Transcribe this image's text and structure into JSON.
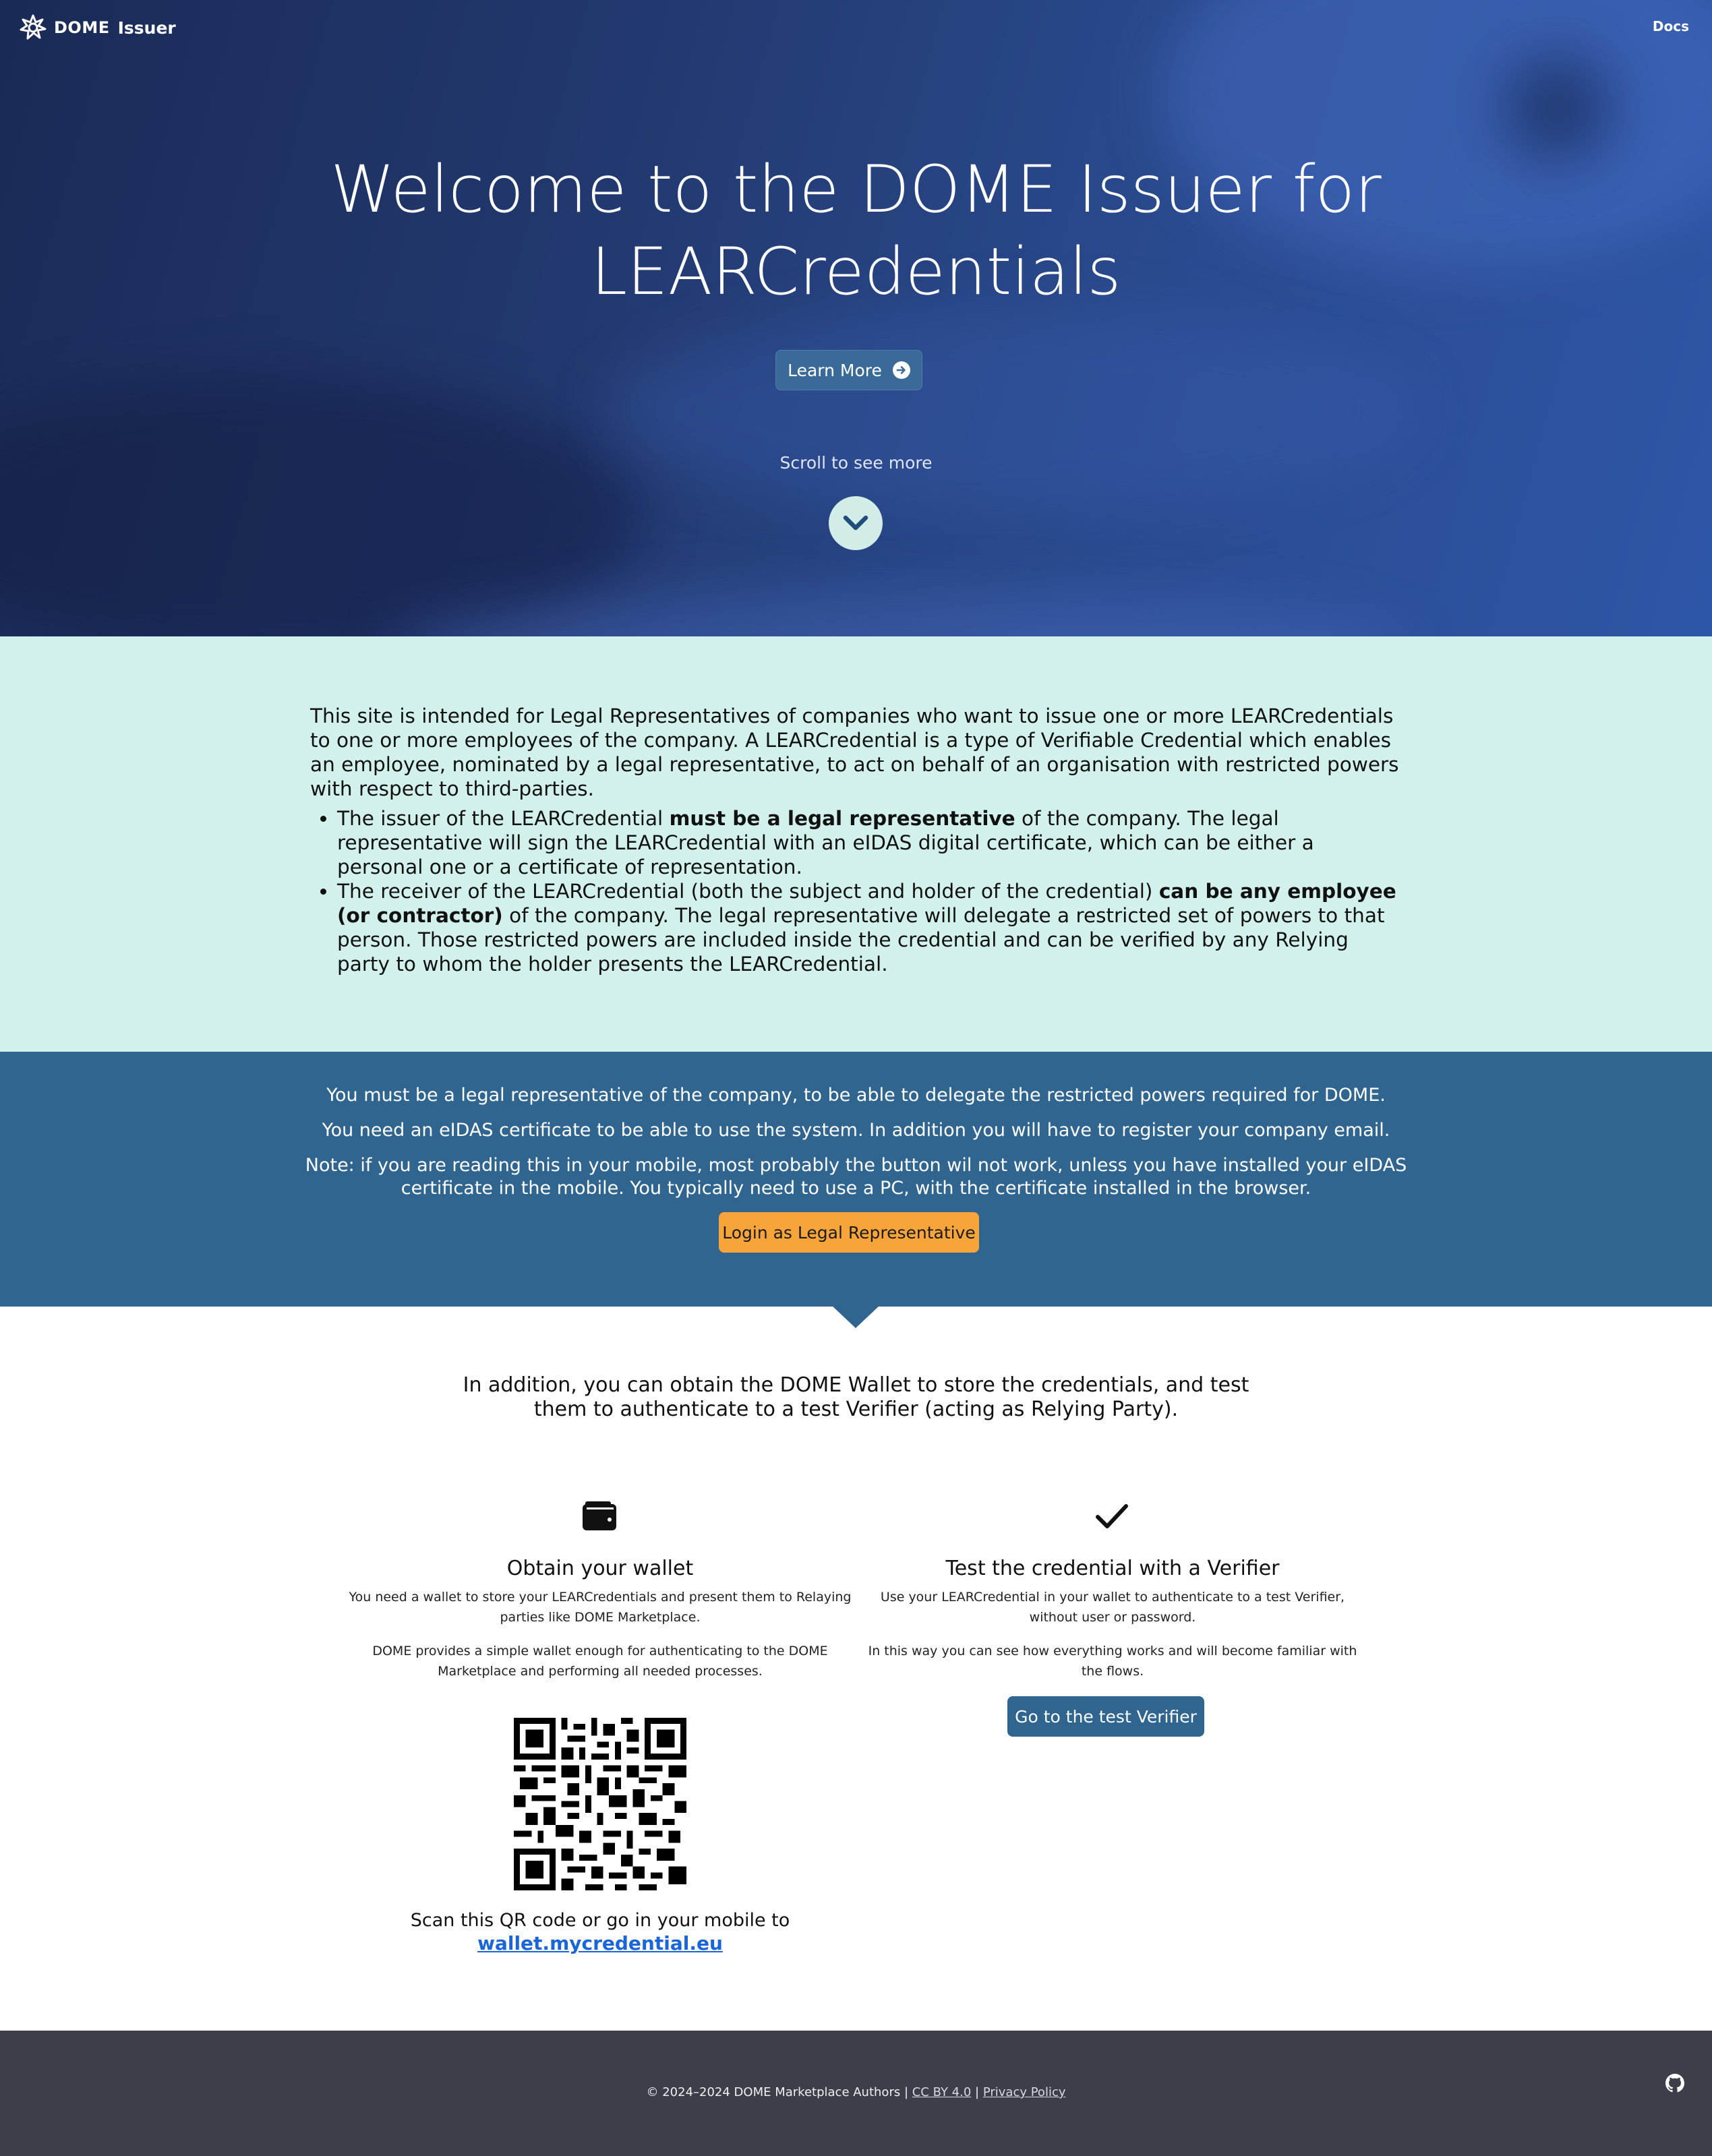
{
  "nav": {
    "brand_dome": "DOME",
    "brand_issuer": "Issuer",
    "docs_label": "Docs"
  },
  "hero": {
    "title_line1": "Welcome to the DOME Issuer for",
    "title_line2": "LEARCredentials",
    "learn_more_label": "Learn More",
    "scroll_hint": "Scroll to see more"
  },
  "intro": {
    "paragraph": "This site is intended for Legal Representatives of companies who want to issue one or more LEARCredentials to one or more employees of the company. A LEARCredential is a type of Verifiable Credential which enables an employee, nominated by a legal representative, to act on behalf of an organisation with restricted powers with respect to third-parties.",
    "bullet1_pre": "The issuer of the LEARCredential ",
    "bullet1_bold": "must be a legal representative",
    "bullet1_post": " of the company. The legal representative will sign the LEARCredential with an eIDAS digital certificate, which can be either a personal one or a certificate of representation.",
    "bullet2_pre": "The receiver of the LEARCredential (both the subject and holder of the credential) ",
    "bullet2_bold": "can be any employee (or contractor)",
    "bullet2_post": " of the company. The legal representative will delegate a restricted set of powers to that person. Those restricted powers are included inside the credential and can be verified by any Relying party to whom the holder presents the LEARCredential."
  },
  "notice": {
    "line1": "You must be a legal representative of the company, to be able to delegate the restricted powers required for DOME.",
    "line2": "You need an eIDAS certificate to be able to use the system. In addition you will have to register your company email.",
    "line3a": "Note: if you are reading this in your mobile, most probably the button wil not work, unless you have installed your eIDAS",
    "line3b": "certificate in the mobile. You typically need to use a PC, with the certificate installed in the browser.",
    "login_label": "Login as Legal Representative"
  },
  "lower": {
    "intro_line1": "In addition, you can obtain the DOME Wallet to store the credentials, and test",
    "intro_line2": "them to authenticate to a test Verifier (acting as Relying Party).",
    "wallet": {
      "title": "Obtain your wallet",
      "p1a": "You need a wallet to store your LEARCredentials and present them to Relaying",
      "p1b": "parties like DOME Marketplace.",
      "p2a": "DOME provides a simple wallet enough for authenticating to the DOME",
      "p2b": "Marketplace and performing all needed processes.",
      "scan_text": "Scan this QR code or go in your mobile to",
      "scan_link": "wallet.mycredential.eu"
    },
    "verifier": {
      "title": "Test the credential with a Verifier",
      "p1a": "Use your LEARCredential in your wallet to authenticate to a test Verifier,",
      "p1b": "without user or password.",
      "p2a": "In this way you can see how everything works and will become familiar with",
      "p2b": "the flows.",
      "button_label": "Go to the test Verifier"
    }
  },
  "footer": {
    "copyright": "© 2024–2024  DOME Marketplace Authors | ",
    "license_label": "CC BY 4.0",
    "separator": " | ",
    "privacy_label": "Privacy Policy"
  },
  "icons": {
    "brand_logo": "dome-logo-icon",
    "learn_more_arrow": "arrow-circle-right-icon",
    "scroll_down": "chevron-down-icon",
    "wallet": "wallet-icon",
    "verifier": "check-icon",
    "github": "github-icon"
  },
  "colors": {
    "hero_bg": "#22396f",
    "intro_bg": "#d2f1ec",
    "notice_bg": "#30658f",
    "login_button": "#f7a43a",
    "link": "#1a66d8",
    "footer_bg": "#3e3e4a"
  }
}
